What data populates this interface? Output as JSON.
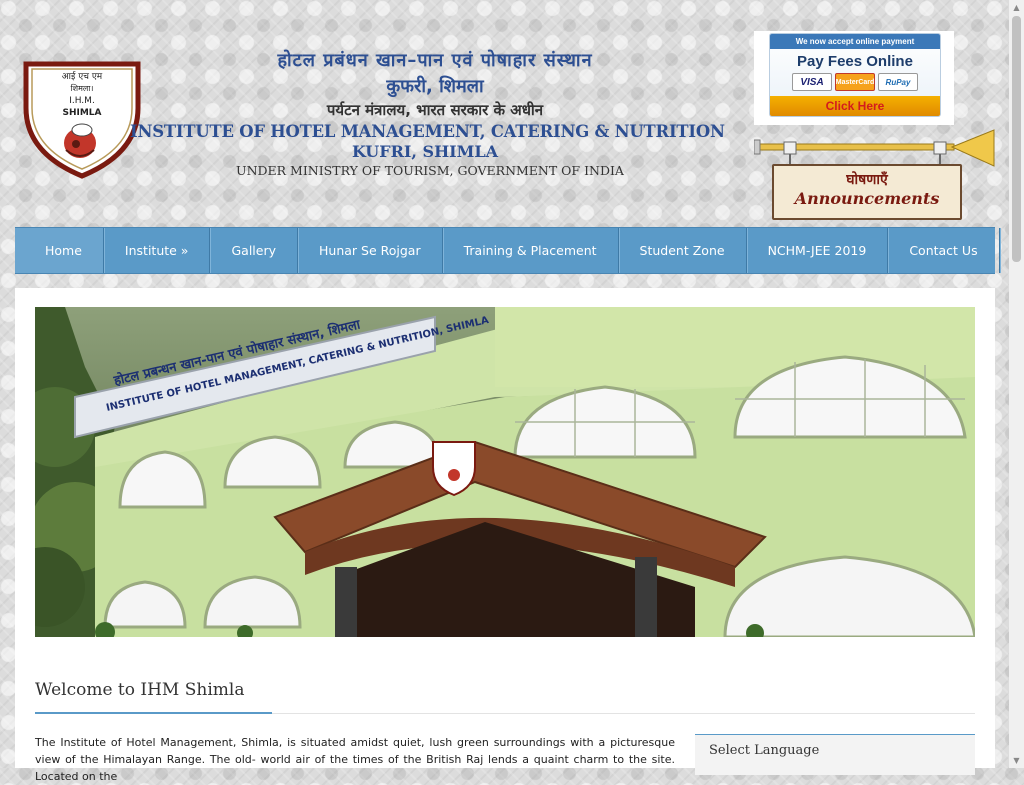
{
  "header": {
    "logo_text": [
      "आई एच एम",
      "शिमला।",
      "I.H.M.",
      "SHIMLA"
    ],
    "hindi_line1": "होटल प्रबंधन खान–पान एवं पोषाहार संस्थान",
    "hindi_line2": "कुफरी, शिमला",
    "hindi_line3": "पर्यटन मंत्रालय, भारत सरकार के अधीन",
    "english_line1": "INSTITUTE OF HOTEL MANAGEMENT, CATERING & NUTRITION",
    "english_line2": "KUFRI, SHIMLA",
    "english_line3": "UNDER MINISTRY OF TOURISM, GOVERNMENT OF INDIA"
  },
  "pay_banner": {
    "top": "We now accept online payment",
    "title": "Pay Fees Online",
    "cards": [
      "VISA",
      "MasterCard",
      "RuPay"
    ],
    "cta": "Click Here"
  },
  "announcements": {
    "hindi": "घोषणाएँ",
    "english": "Announcements"
  },
  "nav": {
    "items": [
      {
        "label": "Home"
      },
      {
        "label": "Institute  »"
      },
      {
        "label": "Gallery"
      },
      {
        "label": "Hunar Se Rojgar"
      },
      {
        "label": "Training & Placement"
      },
      {
        "label": "Student Zone"
      },
      {
        "label": "NCHM-JEE 2019"
      },
      {
        "label": "Contact Us"
      }
    ]
  },
  "hero": {
    "building_sign": "होटल प्रबन्धन खान-पान एवं पोषाहार संस्थान, शिमला",
    "building_sign_en": "INSTITUTE OF HOTEL MANAGEMENT, CATERING & NUTRITION, SHIMLA"
  },
  "welcome": {
    "title": "Welcome to IHM Shimla",
    "intro": "The Institute of Hotel Management, Shimla, is situated amidst quiet, lush green surroundings with a picturesque view of the Himalayan Range. The old- world air of the times of the British Raj lends a quaint charm to the site. Located on the"
  },
  "sidebar": {
    "language_label": "Select Language"
  },
  "colors": {
    "nav": "#5a9ac8",
    "title_blue": "#2d4f92",
    "logo_maroon": "#7a1a10"
  }
}
